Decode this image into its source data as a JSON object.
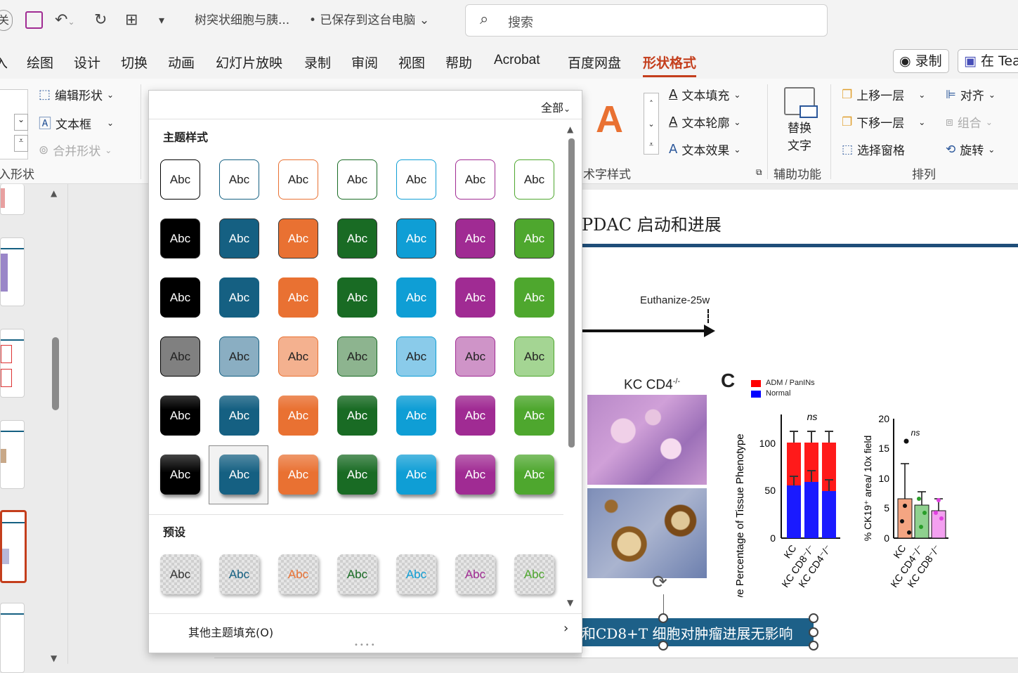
{
  "titlebar": {
    "close_label": "关",
    "filename": "树突状细胞与胰...",
    "save_status": "• 已保存到这台电脑",
    "search_placeholder": "搜索"
  },
  "menu": {
    "tabs": [
      "入",
      "绘图",
      "设计",
      "切换",
      "动画",
      "幻灯片放映",
      "录制",
      "审阅",
      "视图",
      "帮助",
      "Acrobat",
      "百度网盘",
      "形状格式"
    ],
    "active_tab": "形状格式",
    "record_label": "录制",
    "teams_label": "在 Tea"
  },
  "ribbon": {
    "edit_shape": "编辑形状",
    "text_box": "文本框",
    "merge_shapes": "合并形状",
    "insert_shapes_group": "入形状",
    "text_fill": "文本填充",
    "text_outline": "文本轮廓",
    "text_effect": "文本效果",
    "wordart_group": "术字样式",
    "alt_text_line1": "替换",
    "alt_text_line2": "文字",
    "accessibility_group": "辅助功能",
    "bring_forward": "上移一层",
    "send_backward": "下移一层",
    "selection_pane": "选择窗格",
    "align": "对齐",
    "group": "组合",
    "rotate": "旋转",
    "arrange_group": "排列"
  },
  "gallery": {
    "filter_label": "全部",
    "section_theme": "主题样式",
    "section_preset": "预设",
    "sample_text": "Abc",
    "other_fill": "其他主题填充(O)",
    "colors": [
      "#000000",
      "#156082",
      "#e97132",
      "#196b24",
      "#0f9ed5",
      "#a02b93",
      "#4ea72e"
    ],
    "light_colors": [
      "#808080",
      "#8aaec2",
      "#f4b18f",
      "#8db48f",
      "#8acbea",
      "#cf94c8",
      "#a4d593"
    ],
    "selected_row": 6,
    "selected_col": 2
  },
  "slide": {
    "title": "PDAC 启动和进展",
    "euthanize": "Euthanize-25w",
    "panel_label": "KC CD4",
    "panel_sup": "-/-",
    "panel_c": "C",
    "legend": [
      "ADM / PanINs",
      "Normal"
    ],
    "ylabel1": "Relative Percentage of Tissue Phenotype",
    "ylabel2": "% CK19⁺ area/ 10x field",
    "ns": "ns",
    "yticks1": [
      "100",
      "50",
      "0"
    ],
    "yticks2": [
      "20",
      "15",
      "10",
      "5",
      "0"
    ],
    "xlabels1": [
      "KC",
      "KC CD8⁻/⁻",
      "KC CD4⁻/⁻"
    ],
    "xlabels2": [
      "KC",
      "KC CD4⁻/⁻",
      "KC CD8⁻/⁻"
    ],
    "banner": "和CD8+T 细胞对肿瘤进展无影响"
  }
}
